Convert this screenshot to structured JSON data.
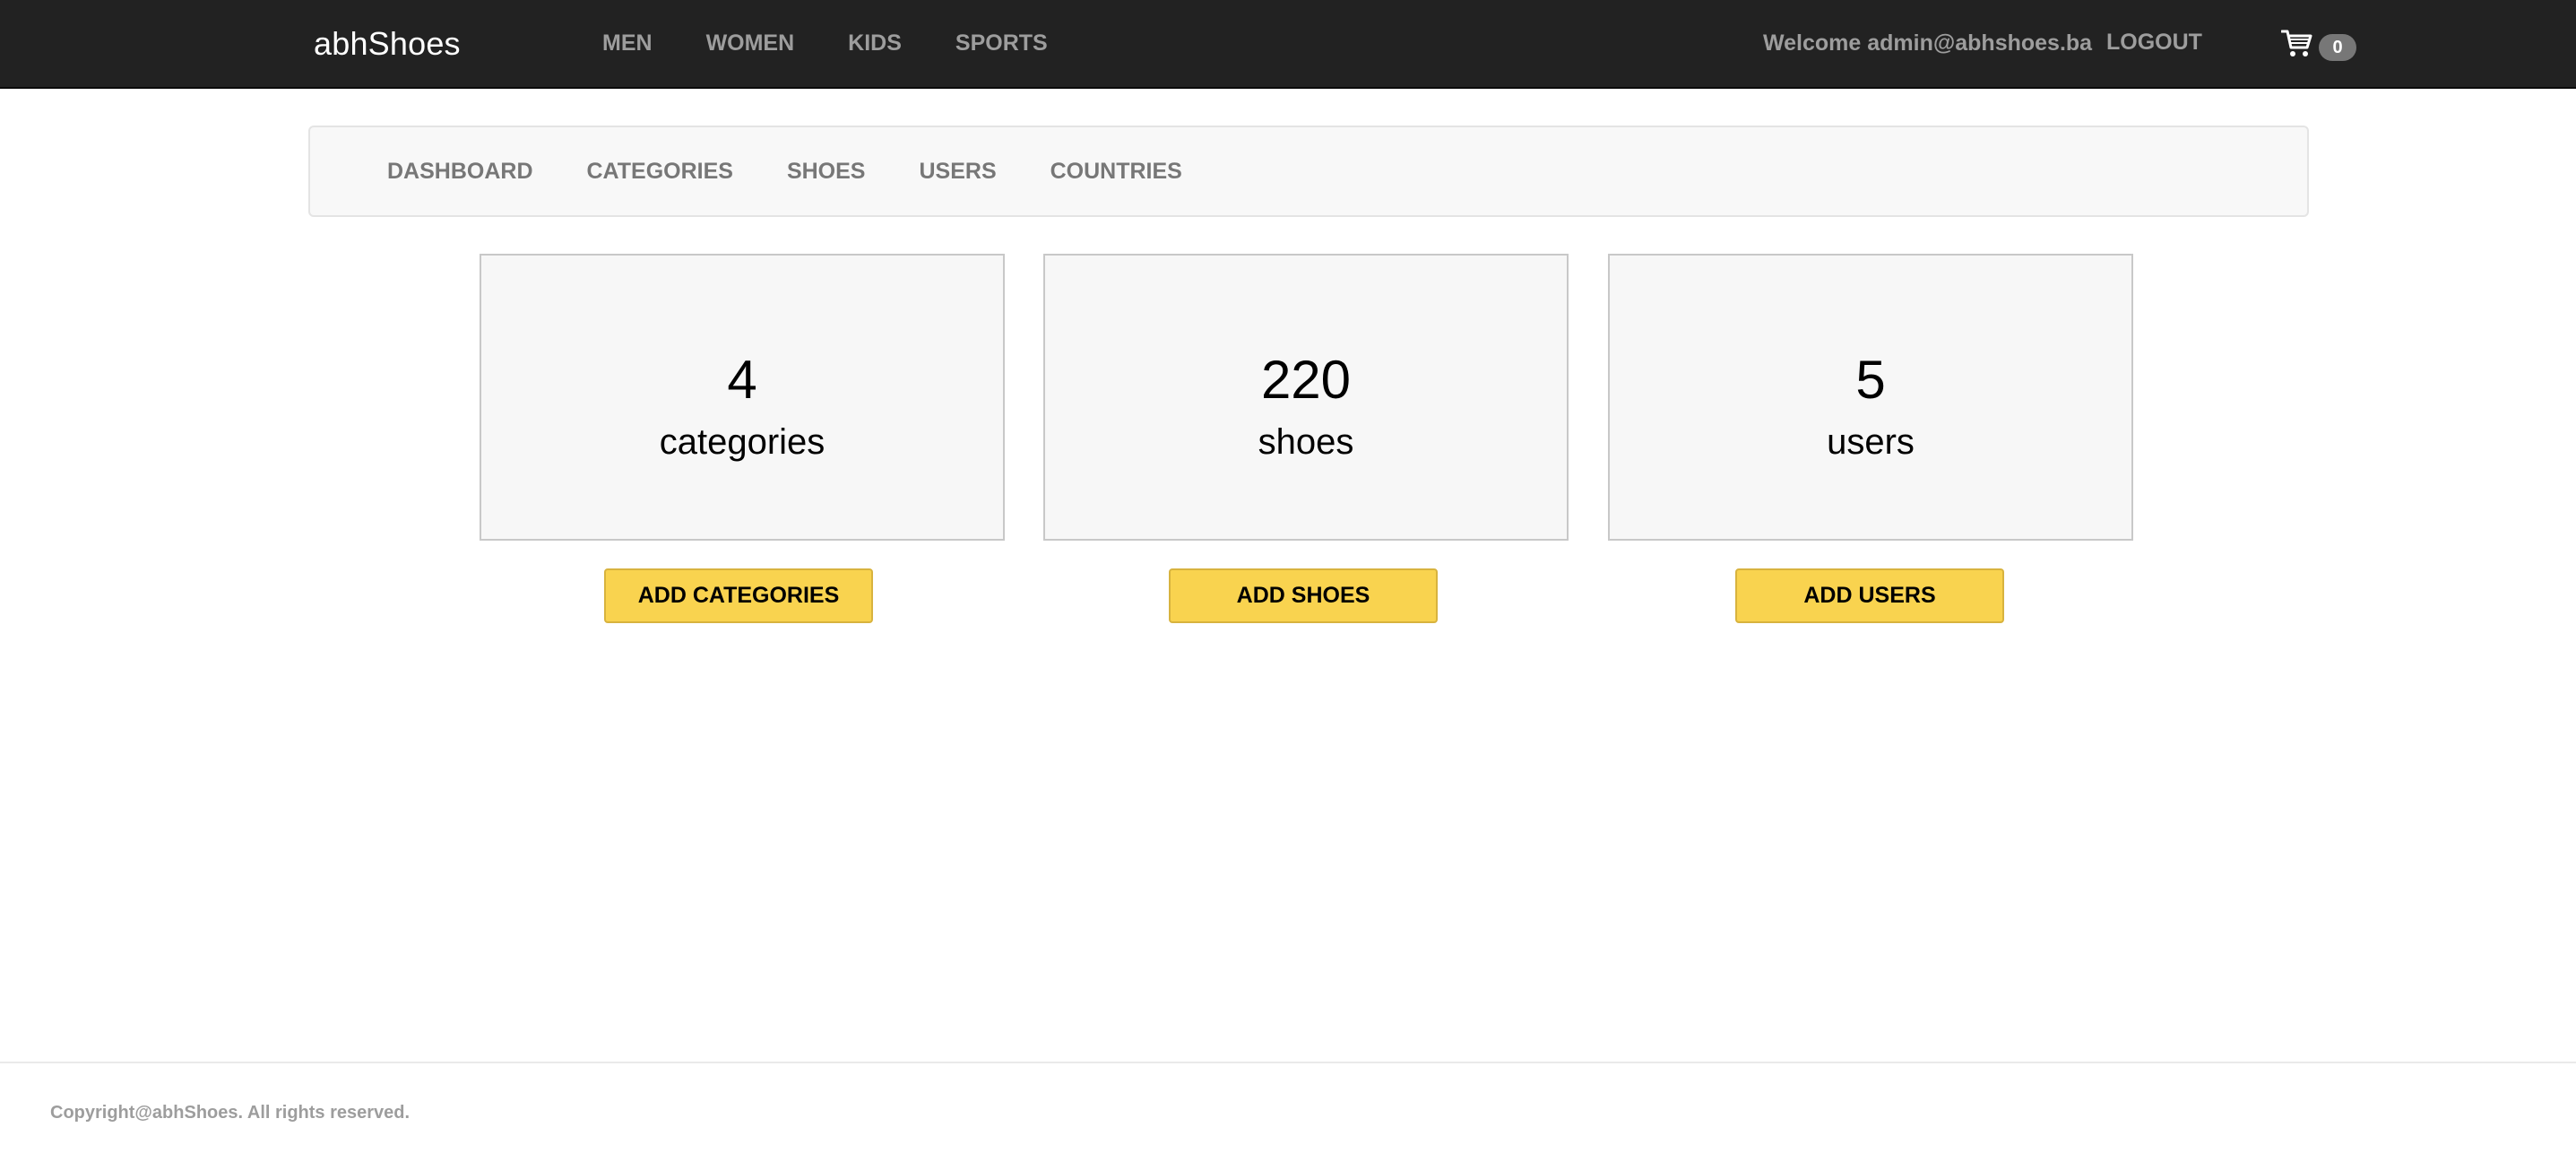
{
  "navbar": {
    "brand": "abhShoes",
    "menu": [
      {
        "label": "MEN"
      },
      {
        "label": "WOMEN"
      },
      {
        "label": "KIDS"
      },
      {
        "label": "SPORTS"
      }
    ],
    "welcome": "Welcome admin@abhshoes.ba",
    "logout": "LOGOUT",
    "cart": {
      "icon": "shopping-cart-icon",
      "count": "0"
    }
  },
  "admin_nav": {
    "items": [
      {
        "label": "DASHBOARD"
      },
      {
        "label": "CATEGORIES"
      },
      {
        "label": "SHOES"
      },
      {
        "label": "USERS"
      },
      {
        "label": "COUNTRIES"
      }
    ]
  },
  "stats": [
    {
      "count": "4",
      "label": "categories",
      "button": "ADD CATEGORIES"
    },
    {
      "count": "220",
      "label": "shoes",
      "button": "ADD SHOES"
    },
    {
      "count": "5",
      "label": "users",
      "button": "ADD USERS"
    }
  ],
  "footer": {
    "copyright": "Copyright@abhShoes. All rights reserved."
  },
  "colors": {
    "navbar_bg": "#222222",
    "nav_text": "#9d9d9d",
    "button_bg": "#f9d34f",
    "card_bg": "#f7f7f7"
  }
}
